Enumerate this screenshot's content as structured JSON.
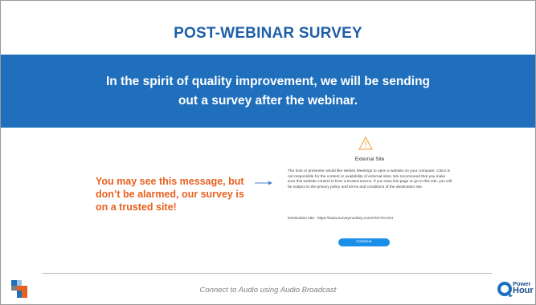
{
  "slide": {
    "title": "POST-WEBINAR SURVEY",
    "banner_text": "In the spirit of quality improvement, we will be sending out a survey after the webinar."
  },
  "callout": {
    "text": "You may see this message, but don’t be alarmed, our survey is on a trusted site!"
  },
  "dialog": {
    "title": "External Site",
    "body": "The host or presenter would like Webex Meetings to open a website on your computer. Cisco is not responsible for the content or availability of external sites. We recommend that you make sure this website content is from a trusted source. If you view this page or go to this site, you will be subject to the privacy policy and terms and conditions of the destination site.",
    "destination_label": "Destination site:",
    "destination_url": "https://www.surveymonkey.com/r/XGTCCXH",
    "continue_label": "Continue"
  },
  "footer": {
    "text": "Connect to Audio using Audio Broadcast",
    "logo_power": "Power",
    "logo_hour": "Hour"
  },
  "colors": {
    "title": "#1f5fa8",
    "banner": "#1f6fbd",
    "callout": "#e8601f",
    "button": "#1a8fe8"
  }
}
